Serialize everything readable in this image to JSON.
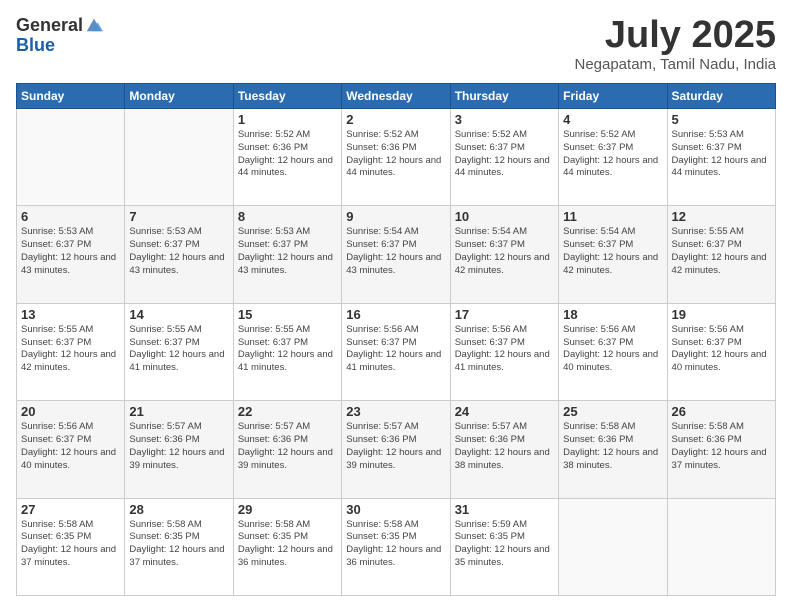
{
  "logo": {
    "general": "General",
    "blue": "Blue"
  },
  "header": {
    "month": "July 2025",
    "location": "Negapatam, Tamil Nadu, India"
  },
  "weekdays": [
    "Sunday",
    "Monday",
    "Tuesday",
    "Wednesday",
    "Thursday",
    "Friday",
    "Saturday"
  ],
  "weeks": [
    [
      {
        "day": null
      },
      {
        "day": null
      },
      {
        "day": 1,
        "sunrise": "5:52 AM",
        "sunset": "6:36 PM",
        "daylight": "12 hours and 44 minutes."
      },
      {
        "day": 2,
        "sunrise": "5:52 AM",
        "sunset": "6:36 PM",
        "daylight": "12 hours and 44 minutes."
      },
      {
        "day": 3,
        "sunrise": "5:52 AM",
        "sunset": "6:37 PM",
        "daylight": "12 hours and 44 minutes."
      },
      {
        "day": 4,
        "sunrise": "5:52 AM",
        "sunset": "6:37 PM",
        "daylight": "12 hours and 44 minutes."
      },
      {
        "day": 5,
        "sunrise": "5:53 AM",
        "sunset": "6:37 PM",
        "daylight": "12 hours and 44 minutes."
      }
    ],
    [
      {
        "day": 6,
        "sunrise": "5:53 AM",
        "sunset": "6:37 PM",
        "daylight": "12 hours and 43 minutes."
      },
      {
        "day": 7,
        "sunrise": "5:53 AM",
        "sunset": "6:37 PM",
        "daylight": "12 hours and 43 minutes."
      },
      {
        "day": 8,
        "sunrise": "5:53 AM",
        "sunset": "6:37 PM",
        "daylight": "12 hours and 43 minutes."
      },
      {
        "day": 9,
        "sunrise": "5:54 AM",
        "sunset": "6:37 PM",
        "daylight": "12 hours and 43 minutes."
      },
      {
        "day": 10,
        "sunrise": "5:54 AM",
        "sunset": "6:37 PM",
        "daylight": "12 hours and 42 minutes."
      },
      {
        "day": 11,
        "sunrise": "5:54 AM",
        "sunset": "6:37 PM",
        "daylight": "12 hours and 42 minutes."
      },
      {
        "day": 12,
        "sunrise": "5:55 AM",
        "sunset": "6:37 PM",
        "daylight": "12 hours and 42 minutes."
      }
    ],
    [
      {
        "day": 13,
        "sunrise": "5:55 AM",
        "sunset": "6:37 PM",
        "daylight": "12 hours and 42 minutes."
      },
      {
        "day": 14,
        "sunrise": "5:55 AM",
        "sunset": "6:37 PM",
        "daylight": "12 hours and 41 minutes."
      },
      {
        "day": 15,
        "sunrise": "5:55 AM",
        "sunset": "6:37 PM",
        "daylight": "12 hours and 41 minutes."
      },
      {
        "day": 16,
        "sunrise": "5:56 AM",
        "sunset": "6:37 PM",
        "daylight": "12 hours and 41 minutes."
      },
      {
        "day": 17,
        "sunrise": "5:56 AM",
        "sunset": "6:37 PM",
        "daylight": "12 hours and 41 minutes."
      },
      {
        "day": 18,
        "sunrise": "5:56 AM",
        "sunset": "6:37 PM",
        "daylight": "12 hours and 40 minutes."
      },
      {
        "day": 19,
        "sunrise": "5:56 AM",
        "sunset": "6:37 PM",
        "daylight": "12 hours and 40 minutes."
      }
    ],
    [
      {
        "day": 20,
        "sunrise": "5:56 AM",
        "sunset": "6:37 PM",
        "daylight": "12 hours and 40 minutes."
      },
      {
        "day": 21,
        "sunrise": "5:57 AM",
        "sunset": "6:36 PM",
        "daylight": "12 hours and 39 minutes."
      },
      {
        "day": 22,
        "sunrise": "5:57 AM",
        "sunset": "6:36 PM",
        "daylight": "12 hours and 39 minutes."
      },
      {
        "day": 23,
        "sunrise": "5:57 AM",
        "sunset": "6:36 PM",
        "daylight": "12 hours and 39 minutes."
      },
      {
        "day": 24,
        "sunrise": "5:57 AM",
        "sunset": "6:36 PM",
        "daylight": "12 hours and 38 minutes."
      },
      {
        "day": 25,
        "sunrise": "5:58 AM",
        "sunset": "6:36 PM",
        "daylight": "12 hours and 38 minutes."
      },
      {
        "day": 26,
        "sunrise": "5:58 AM",
        "sunset": "6:36 PM",
        "daylight": "12 hours and 37 minutes."
      }
    ],
    [
      {
        "day": 27,
        "sunrise": "5:58 AM",
        "sunset": "6:35 PM",
        "daylight": "12 hours and 37 minutes."
      },
      {
        "day": 28,
        "sunrise": "5:58 AM",
        "sunset": "6:35 PM",
        "daylight": "12 hours and 37 minutes."
      },
      {
        "day": 29,
        "sunrise": "5:58 AM",
        "sunset": "6:35 PM",
        "daylight": "12 hours and 36 minutes."
      },
      {
        "day": 30,
        "sunrise": "5:58 AM",
        "sunset": "6:35 PM",
        "daylight": "12 hours and 36 minutes."
      },
      {
        "day": 31,
        "sunrise": "5:59 AM",
        "sunset": "6:35 PM",
        "daylight": "12 hours and 35 minutes."
      },
      {
        "day": null
      },
      {
        "day": null
      }
    ]
  ]
}
